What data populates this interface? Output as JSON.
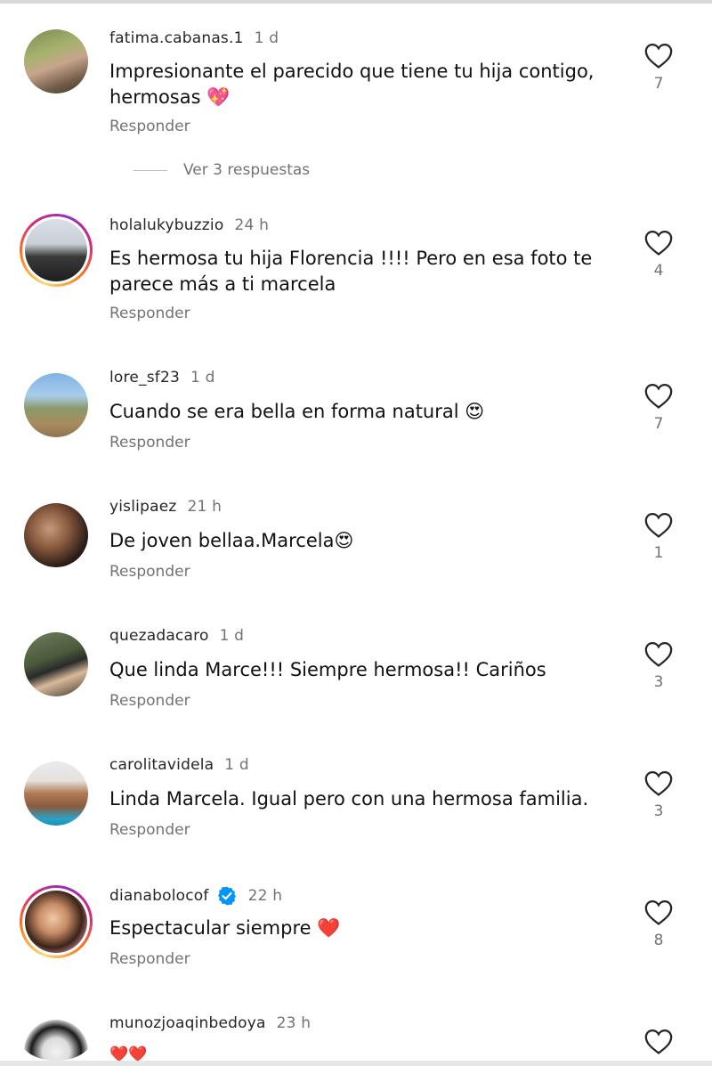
{
  "comments": [
    {
      "user": "fatima.cabanas.1",
      "time": "1 d",
      "text": "Impresionante el parecido que tiene tu hija contigo, hermosas 💖",
      "reply": "Responder",
      "likes": "7",
      "story": false,
      "verified": false
    },
    {
      "user": "holalukybuzzio",
      "time": "24 h",
      "text": "Es hermosa tu hija Florencia !!!! Pero en esa foto te parece más a ti marcela",
      "reply": "Responder",
      "likes": "4",
      "story": true,
      "verified": false
    },
    {
      "user": "lore_sf23",
      "time": "1 d",
      "text": "Cuando se era bella en forma natural 😍",
      "reply": "Responder",
      "likes": "7",
      "story": false,
      "verified": false
    },
    {
      "user": "yislipaez",
      "time": "21 h",
      "text": "De joven bellaa.Marcela😍",
      "reply": "Responder",
      "likes": "1",
      "story": false,
      "verified": false
    },
    {
      "user": "quezadacaro",
      "time": "1 d",
      "text": "Que linda Marce!!! Siempre hermosa!! Cariños",
      "reply": "Responder",
      "likes": "3",
      "story": false,
      "verified": false
    },
    {
      "user": "carolitavidela",
      "time": "1 d",
      "text": "Linda Marcela. Igual pero con una hermosa familia.",
      "reply": "Responder",
      "likes": "3",
      "story": false,
      "verified": false
    },
    {
      "user": "dianabolocof",
      "time": "22 h",
      "text": "Espectacular siempre ❤️",
      "reply": "Responder",
      "likes": "8",
      "story": true,
      "verified": true
    },
    {
      "user": "munozjoaqinbedoya",
      "time": "23 h",
      "text": "❤️❤️",
      "reply": "",
      "likes": "",
      "story": false,
      "verified": false
    }
  ],
  "view_replies": "Ver 3 respuestas",
  "colors": {
    "muted": "#737373",
    "verified": "#0095f6",
    "heart_outline": "#262626"
  }
}
